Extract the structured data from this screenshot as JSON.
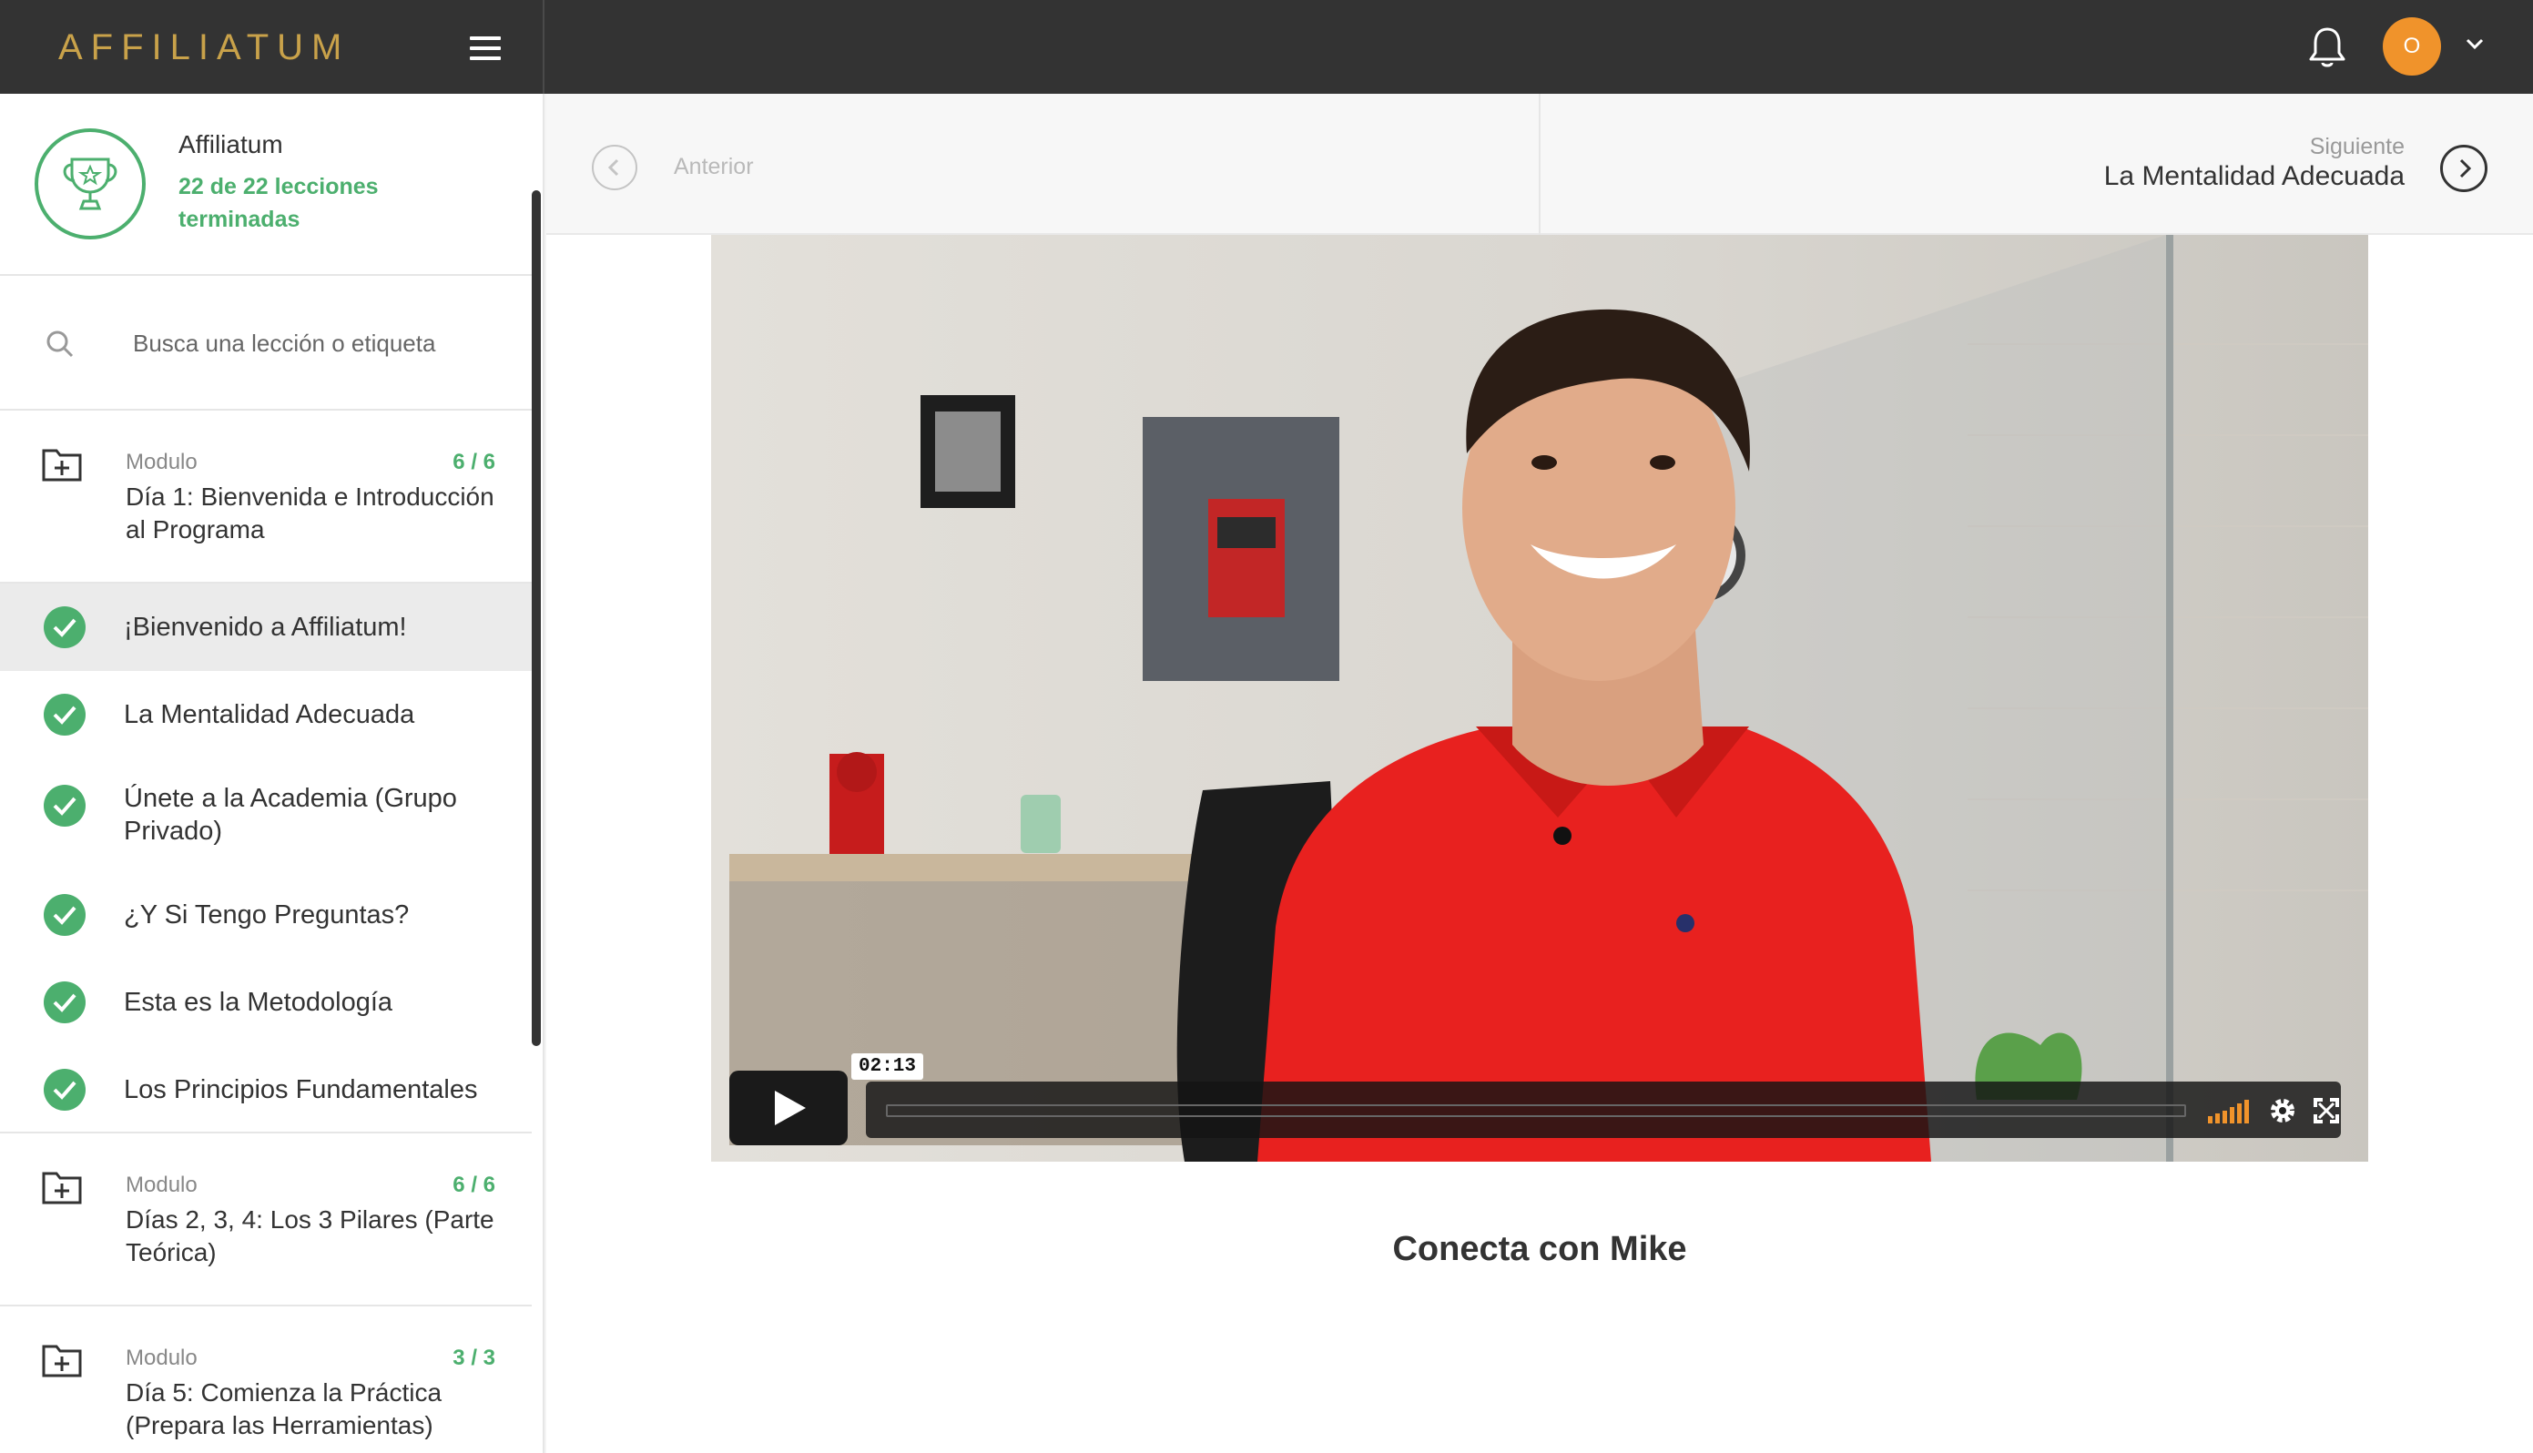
{
  "brand": {
    "logo_text": "AFFILIATUM"
  },
  "header": {
    "avatar_initial": "O"
  },
  "course": {
    "name": "Affiliatum",
    "progress_text": "22 de 22 lecciones terminadas"
  },
  "search": {
    "placeholder": "Busca una lección o etiqueta"
  },
  "modules": [
    {
      "label": "Modulo",
      "count": "6 / 6",
      "title": "Día 1: Bienvenida e Introducción al Programa",
      "lessons": [
        {
          "title": "¡Bienvenido a Affiliatum!",
          "completed": true,
          "active": true
        },
        {
          "title": "La Mentalidad Adecuada",
          "completed": true
        },
        {
          "title": "Únete a la Academia (Grupo Privado)",
          "completed": true
        },
        {
          "title": "¿Y Si Tengo Preguntas?",
          "completed": true
        },
        {
          "title": "Esta es la Metodología",
          "completed": true
        },
        {
          "title": "Los Principios Fundamentales",
          "completed": true
        }
      ]
    },
    {
      "label": "Modulo",
      "count": "6 / 6",
      "title": "Días 2, 3, 4: Los 3 Pilares (Parte Teórica)"
    },
    {
      "label": "Modulo",
      "count": "3 / 3",
      "title": "Día 5: Comienza la Práctica (Prepara las Herramientas)"
    }
  ],
  "navigation": {
    "previous_label": "Anterior",
    "next_label": "Siguiente",
    "next_title": "La Mentalidad Adecuada"
  },
  "video": {
    "timestamp": "02:13",
    "title": "Conecta con Mike"
  },
  "colors": {
    "topbar": "#333333",
    "brand_gold": "#c9a24a",
    "success_green": "#4caf6e",
    "avatar_orange": "#f0932b"
  }
}
